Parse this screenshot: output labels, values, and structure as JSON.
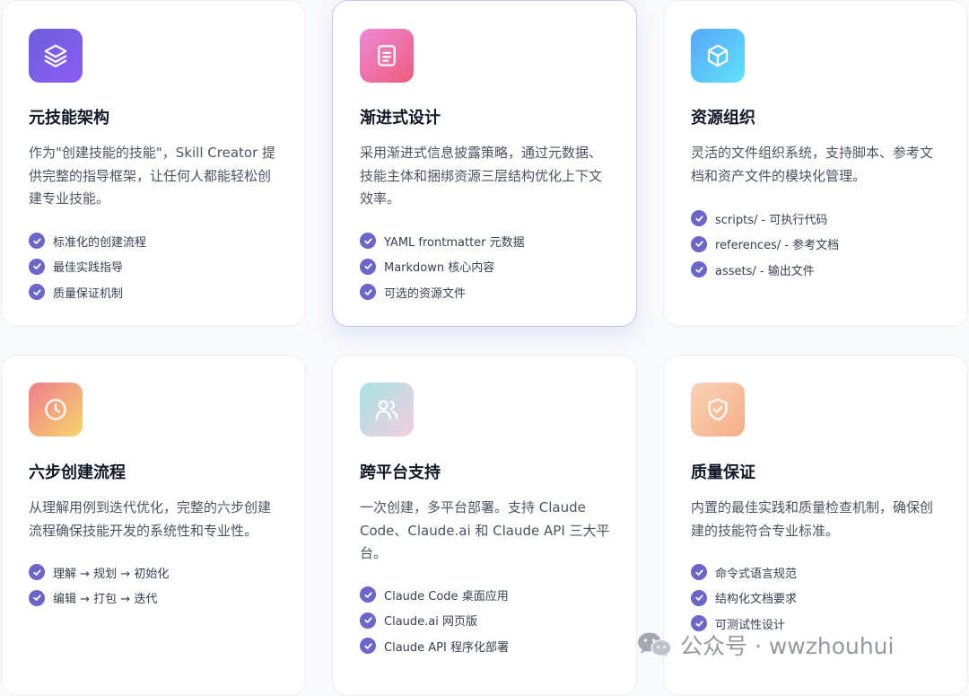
{
  "cards": [
    {
      "title": "元技能架构",
      "desc": "作为\"创建技能的技能\"，Skill Creator 提供完整的指导框架，让任何人都能轻松创建专业技能。",
      "features": [
        "标准化的创建流程",
        "最佳实践指导",
        "质量保证机制"
      ],
      "icon": "layers-icon",
      "gradient": [
        "#6d5fd9",
        "#8b5cf6"
      ]
    },
    {
      "title": "渐进式设计",
      "desc": "采用渐进式信息披露策略，通过元数据、技能主体和捆绑资源三层结构优化上下文效率。",
      "features": [
        "YAML frontmatter 元数据",
        "Markdown 核心内容",
        "可选的资源文件"
      ],
      "icon": "document-icon",
      "gradient": [
        "#ec8ad8",
        "#ee5c7a"
      ]
    },
    {
      "title": "资源组织",
      "desc": "灵活的文件组织系统，支持脚本、参考文档和资产文件的模块化管理。",
      "features": [
        "scripts/ - 可执行代码",
        "references/ - 参考文档",
        "assets/ - 输出文件"
      ],
      "icon": "cube-icon",
      "gradient": [
        "#58a6f8",
        "#5ee3f7"
      ]
    },
    {
      "title": "六步创建流程",
      "desc": "从理解用例到迭代优化，完整的六步创建流程确保技能开发的系统性和专业性。",
      "features": [
        "理解 → 规划 → 初始化",
        "编辑 → 打包 → 迭代"
      ],
      "icon": "clock-icon",
      "gradient": [
        "#f07c8f",
        "#f7d56a"
      ]
    },
    {
      "title": "跨平台支持",
      "desc": "一次创建，多平台部署。支持 Claude Code、Claude.ai 和 Claude API 三大平台。",
      "features": [
        "Claude Code 桌面应用",
        "Claude.ai 网页版",
        "Claude API 程序化部署"
      ],
      "icon": "users-icon",
      "gradient": [
        "#a3e4e0",
        "#f5cde0"
      ]
    },
    {
      "title": "质量保证",
      "desc": "内置的最佳实践和质量检查机制，确保创建的技能符合专业标准。",
      "features": [
        "命令式语言规范",
        "结构化文档要求",
        "可测试性设计"
      ],
      "icon": "shield-check-icon",
      "gradient": [
        "#fbd3b8",
        "#f5ad85"
      ]
    }
  ],
  "accent_check_color": "#6d66c9",
  "watermark": {
    "text": "公众号 · wwzhouhui",
    "icon": "wechat-icon"
  }
}
